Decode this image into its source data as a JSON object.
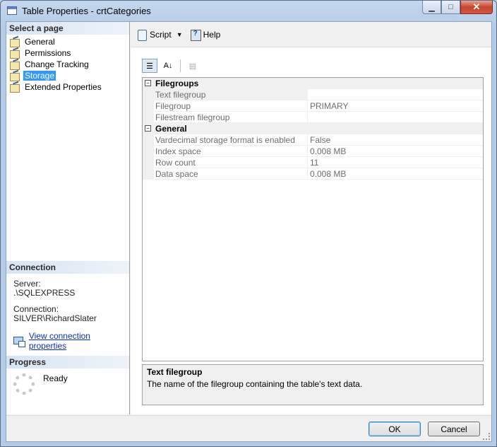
{
  "window": {
    "title": "Table Properties - crtCategories",
    "minimize_glyph": "▁",
    "maximize_glyph": "□",
    "close_glyph": "✕"
  },
  "left": {
    "select_page_header": "Select a page",
    "pages": [
      {
        "label": "General",
        "selected": false
      },
      {
        "label": "Permissions",
        "selected": false
      },
      {
        "label": "Change Tracking",
        "selected": false
      },
      {
        "label": "Storage",
        "selected": true
      },
      {
        "label": "Extended Properties",
        "selected": false
      }
    ],
    "connection_header": "Connection",
    "server_label": "Server:",
    "server_value": ".\\SQLEXPRESS",
    "connection_label": "Connection:",
    "connection_value": "SILVER\\RichardSlater",
    "view_connection_link": "View connection properties",
    "progress_header": "Progress",
    "progress_status": "Ready"
  },
  "toolbar": {
    "script_label": "Script",
    "help_label": "Help",
    "dropdown_glyph": "▼"
  },
  "property_grid": {
    "categorized_glyph": "☰",
    "alphabetical_glyph": "A↓",
    "property_pages_glyph": "▤",
    "rows": [
      {
        "type": "category",
        "name": "Filegroups",
        "toggle": "−"
      },
      {
        "type": "property",
        "name": "Text filegroup",
        "value": "",
        "selected": true
      },
      {
        "type": "property",
        "name": "Filegroup",
        "value": "PRIMARY"
      },
      {
        "type": "property",
        "name": "Filestream filegroup",
        "value": ""
      },
      {
        "type": "category",
        "name": "General",
        "toggle": "−"
      },
      {
        "type": "property",
        "name": "Vardecimal storage format is enabled",
        "value": "False"
      },
      {
        "type": "property",
        "name": "Index space",
        "value": "0.008 MB"
      },
      {
        "type": "property",
        "name": "Row count",
        "value": "11"
      },
      {
        "type": "property",
        "name": "Data space",
        "value": "0.008 MB"
      }
    ]
  },
  "description": {
    "title": "Text filegroup",
    "text": "The name of the filegroup containing the table's text data."
  },
  "footer": {
    "ok_label": "OK",
    "cancel_label": "Cancel"
  }
}
